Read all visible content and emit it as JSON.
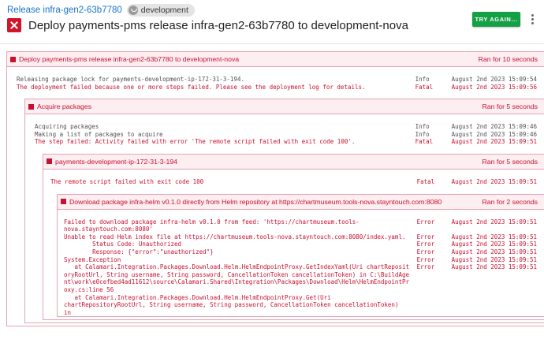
{
  "header": {
    "breadcrumb": "Release infra-gen2-63b7780",
    "environment": "development",
    "title": "Deploy payments-pms release infra-gen2-63b7780 to development-nova",
    "try_again": "TRY AGAIN...",
    "accent_color": "#16a046",
    "error_color": "#c8102e"
  },
  "log": {
    "root": {
      "title": "Deploy payments-pms release infra-gen2-63b7780 to development-nova",
      "ran": "Ran for 10 seconds",
      "lines": [
        {
          "msg": "Releasing package lock for payments-development-ip-172-31-3-194.",
          "level": "Info",
          "time": "August 2nd 2023 15:09:54"
        },
        {
          "msg": "The deployment failed because one or more steps failed. Please see the deployment log for details.",
          "level": "Fatal",
          "time": "August 2nd 2023 15:09:56"
        }
      ]
    },
    "acquire": {
      "title": "Acquire packages",
      "ran": "Ran for 5 seconds",
      "lines": [
        {
          "msg": "Acquiring packages",
          "level": "Info",
          "time": "August 2nd 2023 15:09:46"
        },
        {
          "msg": "Making a list of packages to acquire",
          "level": "Info",
          "time": "August 2nd 2023 15:09:46"
        },
        {
          "msg": "The step failed: Activity failed with error 'The remote script failed with exit code 100'.",
          "level": "Fatal",
          "time": "August 2nd 2023 15:09:51"
        }
      ]
    },
    "target": {
      "title": "payments-development-ip-172-31-3-194",
      "ran": "Ran for 5 seconds",
      "lines": [
        {
          "msg": "The remote script failed with exit code 100",
          "level": "Fatal",
          "time": "August 2nd 2023 15:09:51"
        }
      ]
    },
    "download": {
      "title": "Download package infra-helm v0.1.0 directly from Helm repository at https://chartmuseum.tools-nova.stayntouch.com:8080",
      "ran": "Ran for 2 seconds",
      "lines": [
        {
          "msg": "Failed to download package infra-helm v0.1.0 from feed: 'https://chartmuseum.tools-nova.stayntouch.com:8080'",
          "level": "Error",
          "time": "August 2nd 2023 15:09:51"
        },
        {
          "msg": "Unable to read Helm index file at https://chartmuseum.tools-nova.stayntouch.com:8080/index.yaml.",
          "level": "Error",
          "time": "August 2nd 2023 15:09:51"
        },
        {
          "msg": "        Status Code: Unauthorized",
          "level": "Error",
          "time": "August 2nd 2023 15:09:51"
        },
        {
          "msg": "        Response: {\"error\":\"unauthorized\"}",
          "level": "Error",
          "time": "August 2nd 2023 15:09:51"
        },
        {
          "msg": "System.Exception",
          "level": "Error",
          "time": "August 2nd 2023 15:09:51"
        },
        {
          "msg": "   at Calamari.Integration.Packages.Download.Helm.HelmEndpointProxy.GetIndexYaml(Uri chartRepositoryRootUrl, String username, String password, CancellationToken cancellationToken) in C:\\BuildAgent\\work\\e0cefbed4ad11612\\source\\Calamari.Shared\\Integration\\Packages\\Download\\Helm\\HelmEndpointProxy.cs:line 56",
          "level": "Error",
          "time": "August 2nd 2023 15:09:51"
        },
        {
          "msg": "   at Calamari.Integration.Packages.Download.Helm.HelmEndpointProxy.Get(Uri chartRepositoryRootUrl, String username, String password, CancellationToken cancellationToken) in",
          "level": "",
          "time": ""
        }
      ]
    }
  }
}
